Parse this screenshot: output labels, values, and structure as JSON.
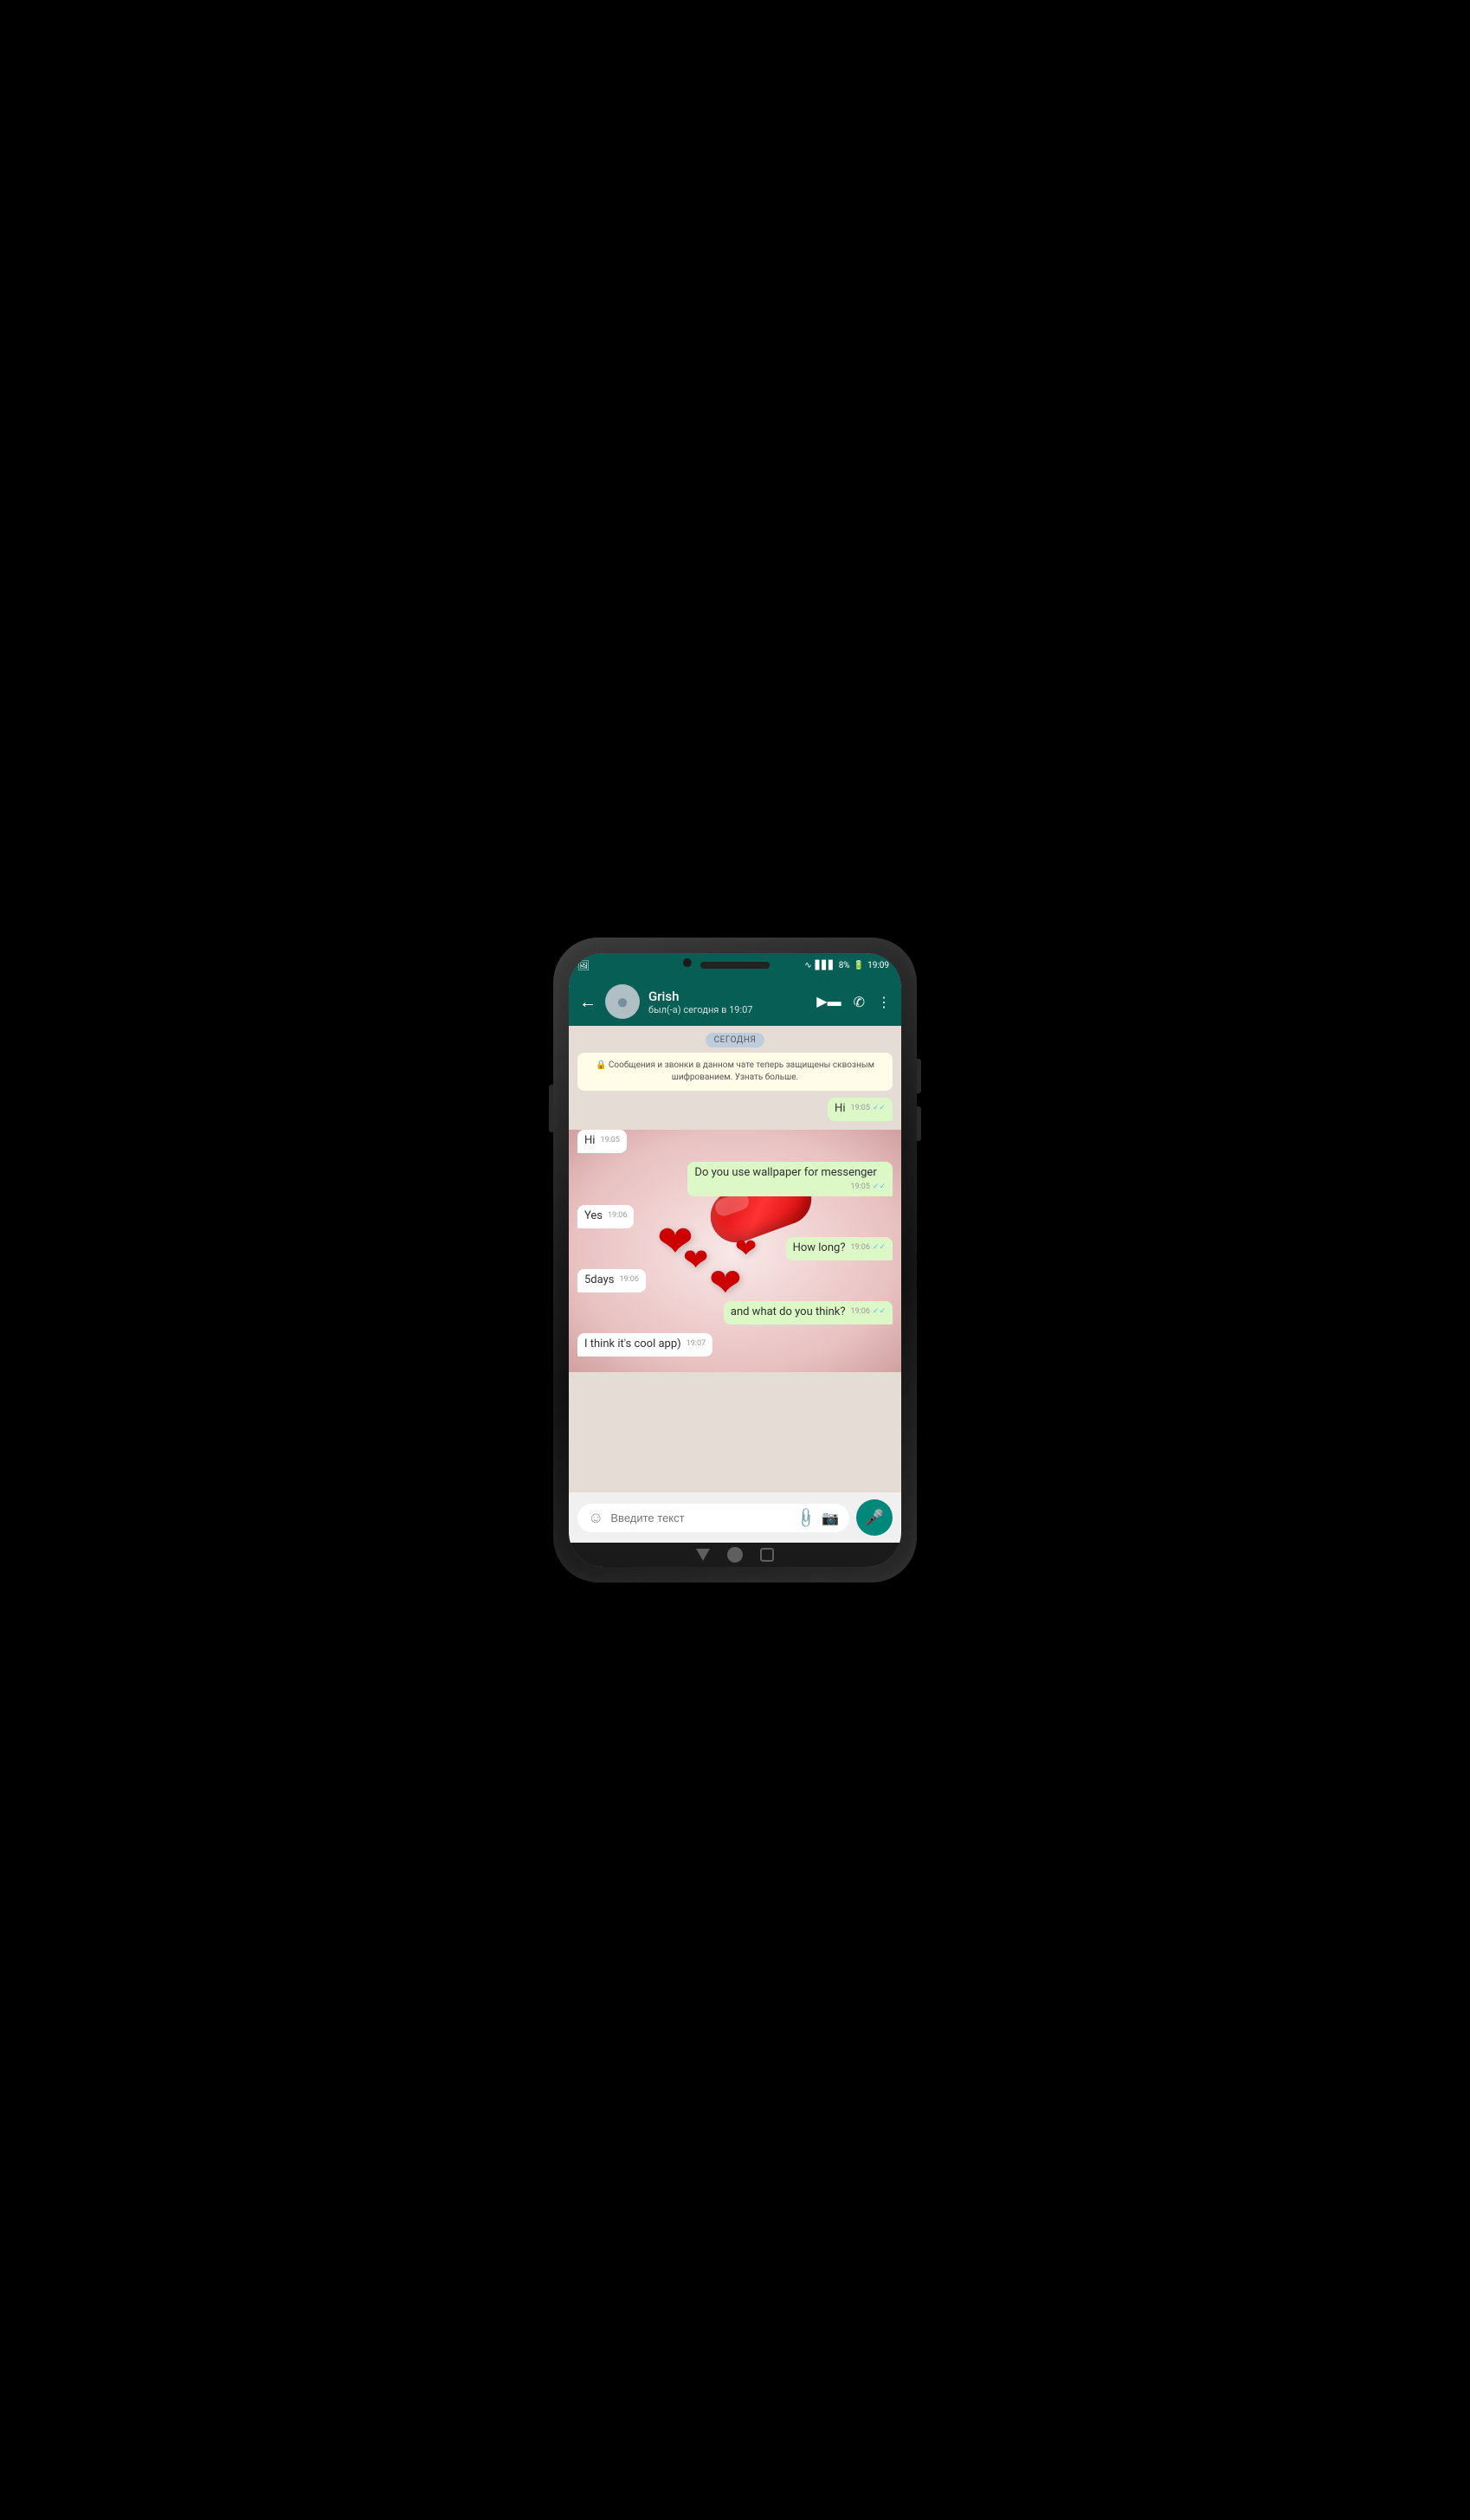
{
  "status_bar": {
    "time": "19:09",
    "battery": "8%",
    "wifi": "WiFi",
    "signal": "Signal"
  },
  "header": {
    "back_label": "←",
    "contact_name": "Grish",
    "contact_status": "был(-а) сегодня в 19:07",
    "video_call_icon": "video-camera",
    "call_icon": "phone",
    "menu_icon": "more-vertical"
  },
  "chat": {
    "date_badge": "СЕГОДНЯ",
    "encryption_notice": "🔒 Сообщения и звонки в данном чате теперь защищены сквозным шифрованием. Узнать больше.",
    "messages": [
      {
        "id": 1,
        "type": "sent",
        "text": "Hi",
        "time": "19:05",
        "read": true,
        "double_check": true
      },
      {
        "id": 2,
        "type": "received",
        "text": "Hi",
        "time": "19:05",
        "read": false,
        "double_check": false
      },
      {
        "id": 3,
        "type": "sent",
        "text": "Do you use wallpaper for messenger",
        "time": "19:05",
        "read": true,
        "double_check": true
      },
      {
        "id": 4,
        "type": "received",
        "text": "Yes",
        "time": "19:06",
        "read": false,
        "double_check": false
      },
      {
        "id": 5,
        "type": "sent",
        "text": "How long?",
        "time": "19:06",
        "read": true,
        "double_check": true
      },
      {
        "id": 6,
        "type": "received",
        "text": "5days",
        "time": "19:06",
        "read": false,
        "double_check": false
      },
      {
        "id": 7,
        "type": "sent",
        "text": "and what do you think?",
        "time": "19:06",
        "read": true,
        "double_check": true
      },
      {
        "id": 8,
        "type": "received",
        "text": "I think it's cool app)",
        "time": "19:07",
        "read": false,
        "double_check": false
      }
    ]
  },
  "input": {
    "placeholder": "Введите текст",
    "emoji_icon": "smile",
    "attach_icon": "paperclip",
    "camera_icon": "camera",
    "mic_icon": "microphone"
  }
}
